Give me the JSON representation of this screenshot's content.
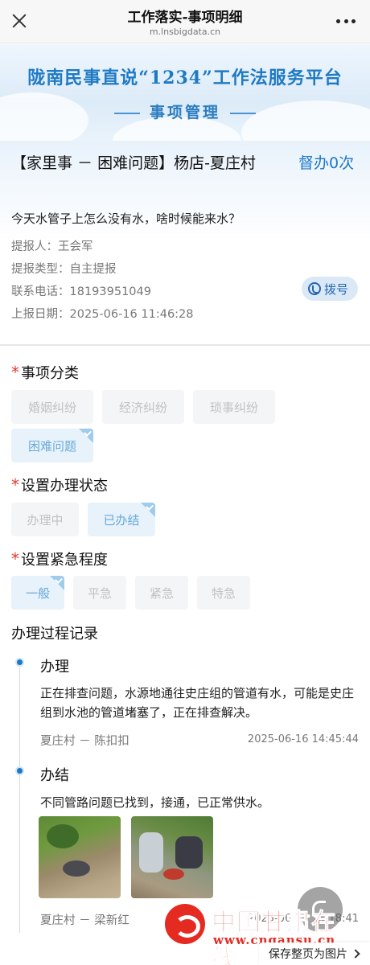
{
  "nav": {
    "title": "工作落实-事项明细",
    "url": "m.lnsbigdata.cn"
  },
  "banner": {
    "brand": "陇南民事直说“1234”工作法服务平台",
    "subtitle": "事项管理"
  },
  "item": {
    "title": "【家里事 － 困难问题】杨店-夏庄村",
    "supervise": "督办0次",
    "question": "今天水管子上怎么没有水，啥时候能来水？",
    "submitter_label": "提报人：",
    "submitter": "王会军",
    "type_label": "提报类型：",
    "type": "自主提报",
    "phone_label": "联系电话：",
    "phone": "18193951049",
    "date_label": "上报日期：",
    "date": "2025-06-16  11:46:28",
    "dial_label": "拨号"
  },
  "category": {
    "title": "事项分类",
    "options": [
      "婚姻纠纷",
      "经济纠纷",
      "琐事纠纷",
      "困难问题"
    ],
    "selected": "困难问题"
  },
  "status": {
    "title": "设置办理状态",
    "options": [
      "办理中",
      "已办结"
    ],
    "selected": "已办结"
  },
  "urgency": {
    "title": "设置紧急程度",
    "options": [
      "一般",
      "平急",
      "紧急",
      "特急"
    ],
    "selected": "一般"
  },
  "process": {
    "title": "办理过程记录",
    "records": [
      {
        "head": "办理",
        "text": "正在排查问题，水源地通往史庄组的管道有水，可能是史庄组到水池的管道堵塞了，正在排查解决。",
        "who": "夏庄村 － 陈扣扣",
        "time": "2025-06-16  14:45:44"
      },
      {
        "head": "办结",
        "text": "不同管路问题已找到，接通，已正常供水。",
        "who": "夏庄村 － 梁新红",
        "time": "2025-06-16  15:18:41"
      }
    ]
  },
  "watermark": {
    "name": "中国甘肃在线",
    "site": "www.cngansu.cn"
  },
  "footer": {
    "save_label": "保存整页为图片"
  }
}
